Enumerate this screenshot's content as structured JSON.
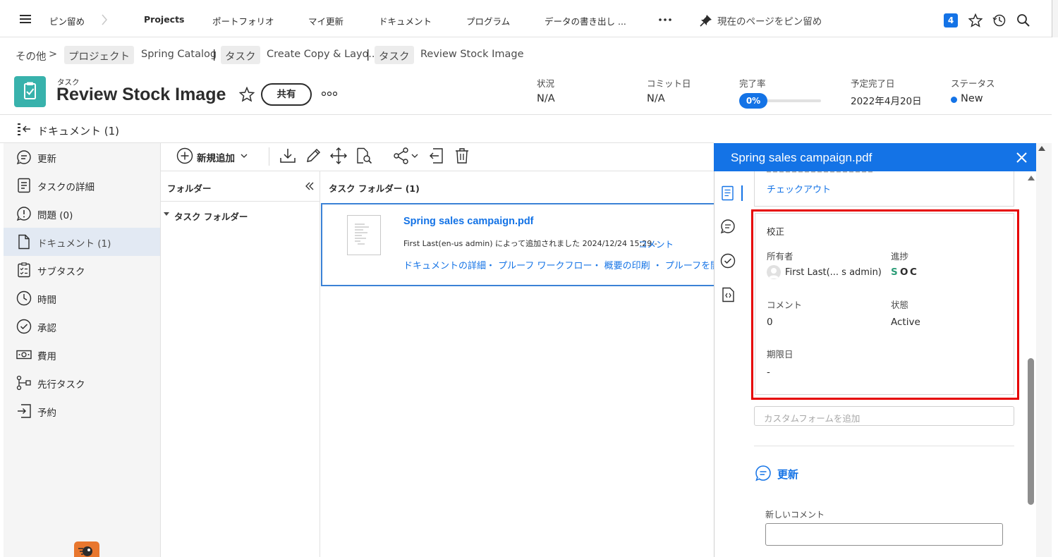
{
  "topnav": {
    "items": [
      "ピン留め",
      "Projects",
      "ポートフォリオ",
      "マイ更新",
      "ドキュメント",
      "プログラム",
      "データの書き出し ..."
    ],
    "pin_label": "現在のページをピン留め",
    "badge": "4"
  },
  "breadcrumb": {
    "more": "その他",
    "chip1": "プロジェクト",
    "text1": "Spring Catalog",
    "chip2": "タスク",
    "text2": "Create Copy & Layo...",
    "chip3": "タスク",
    "text3": "Review Stock Image",
    "sep": "|",
    "more_arrow": ">"
  },
  "header": {
    "type_label": "タスク",
    "title": "Review Stock Image",
    "share_label": "共有",
    "fields": [
      {
        "label": "状況",
        "value": "N/A"
      },
      {
        "label": "コミット日",
        "value": "N/A"
      },
      {
        "label": "完了率",
        "value": "0%",
        "progress": 0
      },
      {
        "label": "予定完了日",
        "value": "2022年4月20日"
      },
      {
        "label": "ステータス",
        "value": "New"
      }
    ]
  },
  "section": {
    "title": "ドキュメント (1)"
  },
  "leftnav": {
    "items": [
      {
        "label": "更新",
        "icon": "comment-icon"
      },
      {
        "label": "タスクの詳細",
        "icon": "details-icon"
      },
      {
        "label": "問題 (0)",
        "icon": "issue-icon"
      },
      {
        "label": "ドキュメント (1)",
        "icon": "document-icon",
        "active": true
      },
      {
        "label": "サブタスク",
        "icon": "subtask-icon"
      },
      {
        "label": "時間",
        "icon": "clock-icon"
      },
      {
        "label": "承認",
        "icon": "approval-icon"
      },
      {
        "label": "費用",
        "icon": "money-icon"
      },
      {
        "label": "先行タスク",
        "icon": "predecessor-icon"
      },
      {
        "label": "予約",
        "icon": "booking-icon"
      }
    ]
  },
  "toolbar": {
    "add_new": "新規追加"
  },
  "folders": {
    "header": "フォルダー",
    "task_folder": "タスク フォルダー",
    "list_header": "タスク フォルダー (1)"
  },
  "document": {
    "name": "Spring sales campaign.pdf",
    "meta": "First Last(en-us admin) によって追加されました 2024/12/24 15:29 -",
    "comment_link": "コメント",
    "links": "ドキュメントの詳細・ プルーフ ワークフロー・ 概要の印刷 ・ プルーフを開"
  },
  "panel": {
    "title": "Spring sales campaign.pdf",
    "checkout": "チェックアウト",
    "proof_title": "校正",
    "owner_label": "所有者",
    "owner_value": "First Last(... s admin)",
    "progress_label": "進捗",
    "progress_letters": [
      "S",
      "O",
      "C"
    ],
    "comments_label": "コメント",
    "comments_value": "0",
    "state_label": "状態",
    "state_value": "Active",
    "due_label": "期限日",
    "due_value": "-",
    "custom_form_placeholder": "カスタムフォームを追加",
    "updates_label": "更新",
    "new_comment_label": "新しいコメント"
  },
  "colors": {
    "accent": "#1473e6",
    "link": "#1473e6",
    "highlight": "#e60000",
    "teal": "#38b2ac",
    "active_nav": "#e2e9f3"
  }
}
